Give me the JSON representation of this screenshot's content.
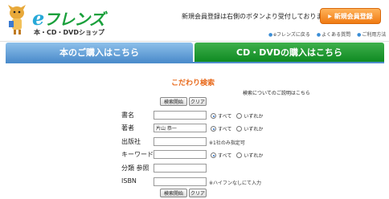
{
  "header": {
    "logo_brand_e": "e",
    "logo_brand_rest": "フレンズ",
    "logo_sub": "本・CD・DVDショップ",
    "signup_text": "新規会員登録は右側のボタンより受付しております。",
    "signup_button": "新規会員登録",
    "links": [
      "eフレンズに戻る",
      "よくある質問",
      "ご利用方法"
    ]
  },
  "tabs": {
    "books": "本のご購入はこちら",
    "cd_dvd": "CD・DVDの購入はこちら"
  },
  "form": {
    "title": "こだわり検索",
    "help_link": "検索についてのご説明はこちら",
    "search_button": "検索開始",
    "clear_button": "クリア",
    "fields": {
      "title_label": "書名",
      "author_label": "著者",
      "author_value": "片山 恭一",
      "publisher_label": "出版社",
      "publisher_note": "※1社のみ指定可",
      "keyword_label": "キーワード",
      "category_label": "分類 参照",
      "isbn_label": "ISBN",
      "isbn_note": "※ハイフンなしにて入力"
    },
    "radio_all": "すべて",
    "radio_any": "いずれか"
  },
  "colors": {
    "accent_orange": "#e86a1c",
    "tab_blue": "#4d8dcc",
    "tab_green": "#0f8a22"
  }
}
